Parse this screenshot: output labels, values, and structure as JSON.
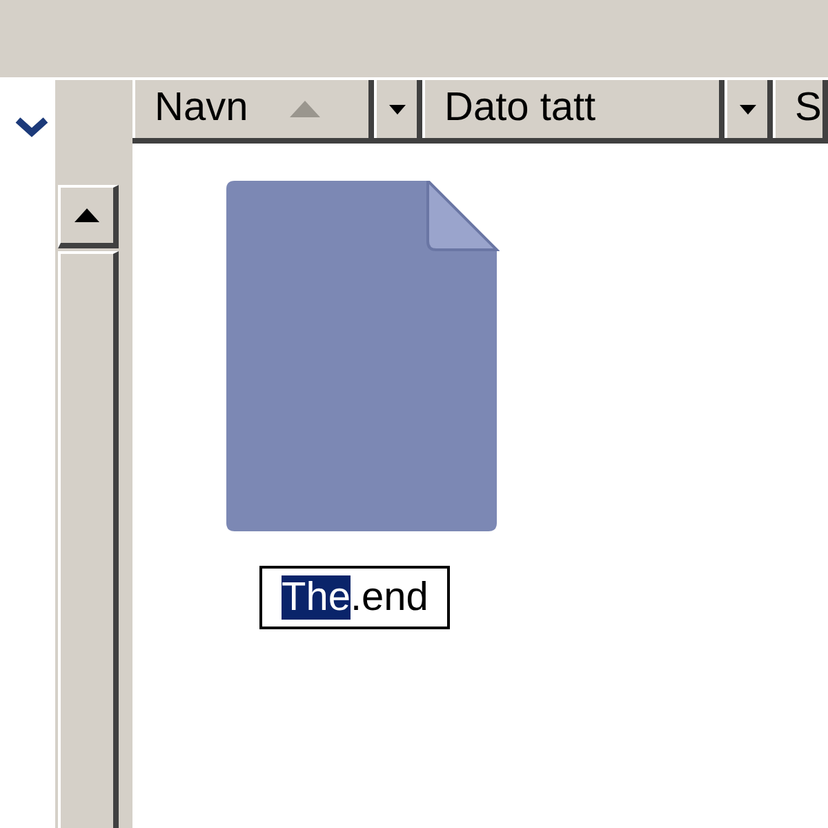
{
  "columns": [
    {
      "label": "Navn",
      "sorted": true,
      "dropdown": true
    },
    {
      "label": "Dato tatt",
      "sorted": false,
      "dropdown": true
    },
    {
      "label": "S"
    }
  ],
  "file": {
    "rename": {
      "selected_text": "The",
      "rest_text": ".end"
    }
  }
}
